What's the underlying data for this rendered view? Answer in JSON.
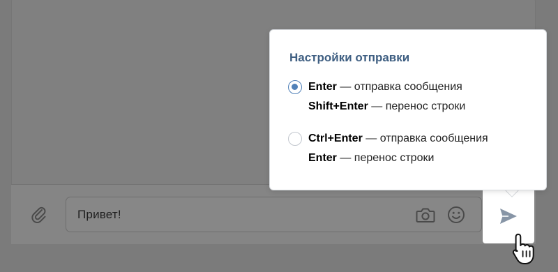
{
  "composer": {
    "message_text": "Привет!",
    "icons": {
      "attach": "paperclip-icon",
      "camera": "camera-icon",
      "emoji": "smile-icon",
      "send": "send-icon"
    }
  },
  "send_settings": {
    "title": "Настройки отправки",
    "options": [
      {
        "selected": true,
        "line1_key": "Enter",
        "line1_text": " — отправка сообщения",
        "line2_key": "Shift+Enter",
        "line2_text": " — перенос строки"
      },
      {
        "selected": false,
        "line1_key": "Ctrl+Enter",
        "line1_text": " — отправка сообщения",
        "line2_key": "Enter",
        "line2_text": " — перенос строки"
      }
    ]
  },
  "colors": {
    "accent": "#5181b8",
    "title": "#3f5f82",
    "overlay": "#7b7b7b"
  }
}
